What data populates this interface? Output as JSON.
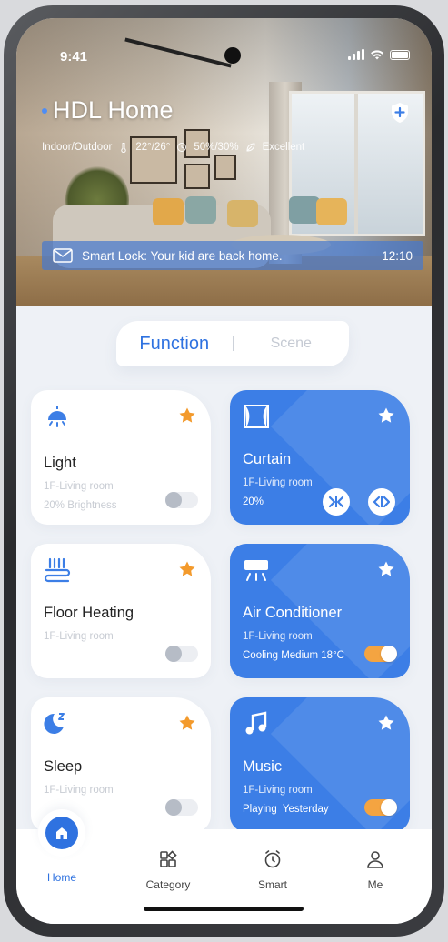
{
  "status_bar": {
    "time": "9:41"
  },
  "hero": {
    "home_name": "HDL Home",
    "env_label": "Indoor/Outdoor",
    "temperature": "22°/26°",
    "humidity": "50%/30%",
    "air_quality": "Excellent",
    "notification": {
      "message": "Smart Lock: Your kid are back home.",
      "time": "12:10"
    }
  },
  "segment": {
    "tabs": [
      "Function",
      "Scene"
    ],
    "active": "Function"
  },
  "cards": [
    {
      "name": "Light",
      "room": "1F-Living room",
      "status": "20% Brightness",
      "icon": "lamp-icon",
      "style": "white",
      "favorite": true,
      "toggle": "off"
    },
    {
      "name": "Curtain",
      "room": "1F-Living room",
      "status": "20%",
      "icon": "curtain-icon",
      "style": "blue",
      "favorite": true,
      "controls": [
        "close-curtain-icon",
        "open-curtain-icon"
      ]
    },
    {
      "name": "Floor Heating",
      "room": "1F-Living room",
      "status": "",
      "icon": "floor-heating-icon",
      "style": "white",
      "favorite": true,
      "toggle": "off"
    },
    {
      "name": "Air Conditioner",
      "room": "1F-Living room",
      "status": "Cooling Medium 18°C",
      "icon": "air-conditioner-icon",
      "style": "blue",
      "favorite": true,
      "toggle": "on"
    },
    {
      "name": "Sleep",
      "room": "1F-Living room",
      "status": "",
      "icon": "moon-icon",
      "style": "white",
      "favorite": true,
      "toggle": "off"
    },
    {
      "name": "Music",
      "room": "1F-Living room",
      "status": "Playing  Yesterday",
      "icon": "music-note-icon",
      "style": "blue",
      "favorite": true,
      "toggle": "on"
    }
  ],
  "tabbar": {
    "items": [
      "Home",
      "Category",
      "Smart",
      "Me"
    ],
    "active": "Home"
  },
  "colors": {
    "accent": "#2f72e0",
    "card_blue": "#3c7ee6",
    "star_orange": "#f39a2c",
    "background": "#eef1f6"
  }
}
